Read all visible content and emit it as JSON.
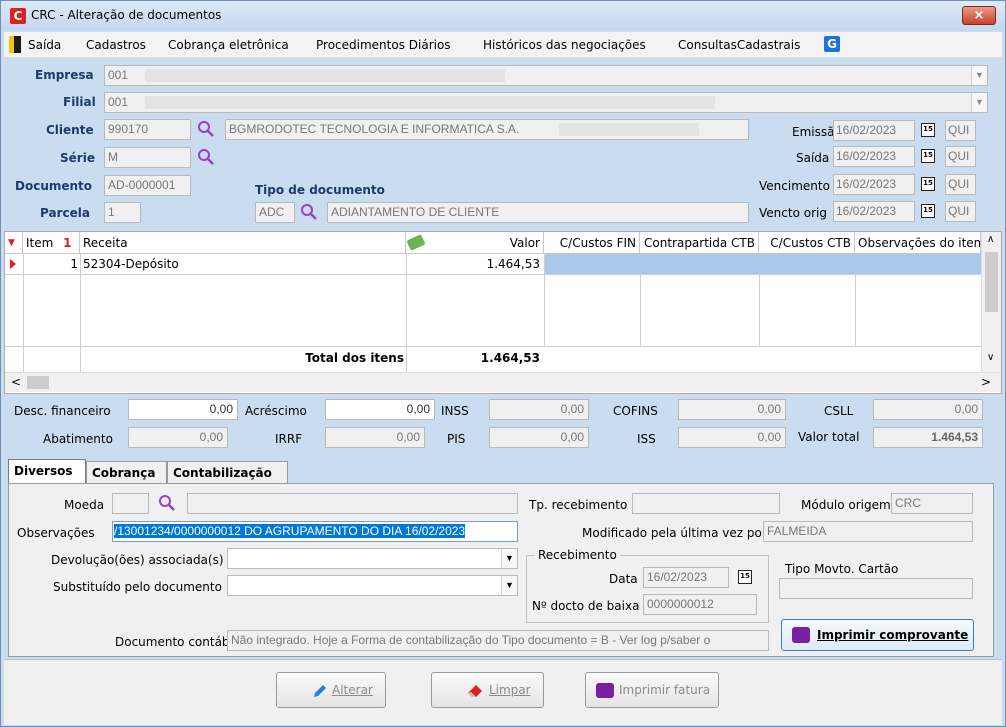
{
  "window": {
    "title": "CRC - Alteração de documentos",
    "close_label": "×",
    "logo": "C"
  },
  "menu": {
    "items": [
      "Saída",
      "Cadastros",
      "Cobrança eletrônica",
      "Procedimentos Diários",
      "Históricos das negociações",
      "ConsultasCadastrais"
    ],
    "g_icon": "G"
  },
  "header": {
    "empresa_label": "Empresa",
    "empresa_value": "001",
    "filial_label": "Filial",
    "filial_value": "001",
    "cliente_label": "Cliente",
    "cliente_code": "990170",
    "cliente_name": "BGMRODOTEC TECNOLOGIA E INFORMATICA S.A.",
    "serie_label": "Série",
    "serie_value": "M",
    "documento_label": "Documento",
    "documento_value": "AD-0000001",
    "parcela_label": "Parcela",
    "parcela_value": "1",
    "tipo_doc_label": "Tipo de documento",
    "tipo_doc_code": "ADC",
    "tipo_doc_name": "ADIANTAMENTO DE CLIENTE",
    "dates": [
      {
        "label": "Emissão",
        "value": "16/02/2023",
        "day": "QUI"
      },
      {
        "label": "Saída",
        "value": "16/02/2023",
        "day": "QUI"
      },
      {
        "label": "Vencimento",
        "value": "16/02/2023",
        "day": "QUI"
      },
      {
        "label": "Vencto orig",
        "value": "16/02/2023",
        "day": "QUI"
      }
    ],
    "cal_icon_text": "15"
  },
  "grid": {
    "headers": [
      "Item",
      "Receita",
      "Valor",
      "C/Custos FIN",
      "Contrapartida CTB",
      "C/Custos CTB",
      "Observações do item"
    ],
    "sort_mark": "1",
    "rows": [
      {
        "item": "1",
        "receita": "52304-Depósito",
        "valor": "1.464,53"
      }
    ],
    "total_label": "Total dos itens",
    "total_value": "1.464,53"
  },
  "totals": {
    "desc_fin_label": "Desc. financeiro",
    "desc_fin_value": "0,00",
    "acrescimo_label": "Acréscimo",
    "acrescimo_value": "0,00",
    "inss_label": "INSS",
    "inss_value": "0,00",
    "cofins_label": "COFINS",
    "cofins_value": "0,00",
    "csll_label": "CSLL",
    "csll_value": "0,00",
    "abatimento_label": "Abatimento",
    "abatimento_value": "0,00",
    "irrf_label": "IRRF",
    "irrf_value": "0,00",
    "pis_label": "PIS",
    "pis_value": "0,00",
    "iss_label": "ISS",
    "iss_value": "0,00",
    "valor_total_label": "Valor total",
    "valor_total_value": "1.464,53"
  },
  "tabs": [
    "Diversos",
    "Cobrança",
    "Contabilização"
  ],
  "diversos": {
    "moeda_label": "Moeda",
    "observacoes_label": "Observações",
    "observacoes_value": "/13001234/0000000012 DO AGRUPAMENTO DO DIA 16/02/2023",
    "devolucao_label": "Devolução(ões) associada(s)",
    "substituido_label": "Substituído pelo documento",
    "tp_recebimento_label": "Tp. recebimento",
    "modulo_origem_label": "Módulo origem",
    "modulo_origem_value": "CRC",
    "modificado_label": "Modificado pela última vez por",
    "modificado_value": "FALMEIDA",
    "recebimento_group": "Recebimento",
    "data_label": "Data",
    "data_value": "16/02/2023",
    "docto_baixa_label": "Nº docto de baixa",
    "docto_baixa_value": "0000000012",
    "tipo_movto_label": "Tipo Movto. Cartão",
    "doc_contabil_label": "Documento contábil",
    "doc_contabil_value": "Não integrado. Hoje a Forma de contabilização do Tipo documento = B - Ver log p/saber o",
    "imprimir_comprovante": "Imprimir comprovante"
  },
  "footer": {
    "alterar": "Alterar",
    "limpar": "Limpar",
    "imprimir_fatura": "Imprimir fatura"
  },
  "colors": {
    "accent": "#0078d7",
    "title_bar": "#c9dcf0",
    "icon_purple": "#7a1fa2",
    "red": "#d8231f"
  }
}
